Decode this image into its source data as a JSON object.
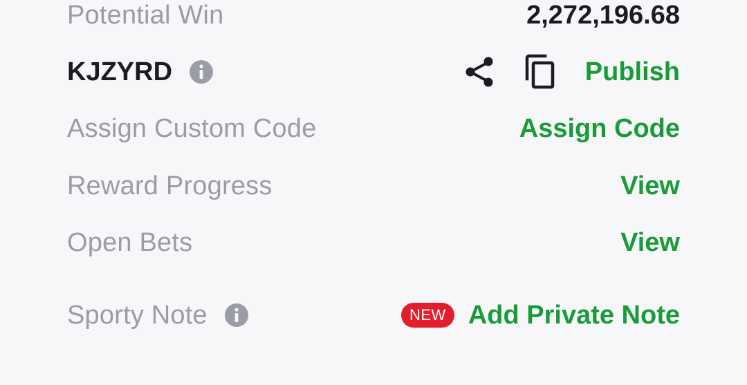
{
  "potential_win": {
    "label": "Potential Win",
    "value": "2,272,196.68"
  },
  "booking": {
    "code": "KJZYRD",
    "info_icon": "info-icon",
    "share_icon": "share-icon",
    "copy_icon": "copy-icon",
    "publish_label": "Publish"
  },
  "custom_code": {
    "label": "Assign Custom Code",
    "action": "Assign Code"
  },
  "reward_progress": {
    "label": "Reward Progress",
    "action": "View"
  },
  "open_bets": {
    "label": "Open Bets",
    "action": "View"
  },
  "sporty_note": {
    "label": "Sporty Note",
    "info_icon": "info-icon",
    "badge": "NEW",
    "action": "Add Private Note"
  },
  "colors": {
    "accent_green": "#1a9b3a",
    "badge_red": "#e41d2d",
    "muted_text": "#9a9ca6",
    "dark_text": "#1b1c22",
    "background": "#f7f7f9"
  }
}
